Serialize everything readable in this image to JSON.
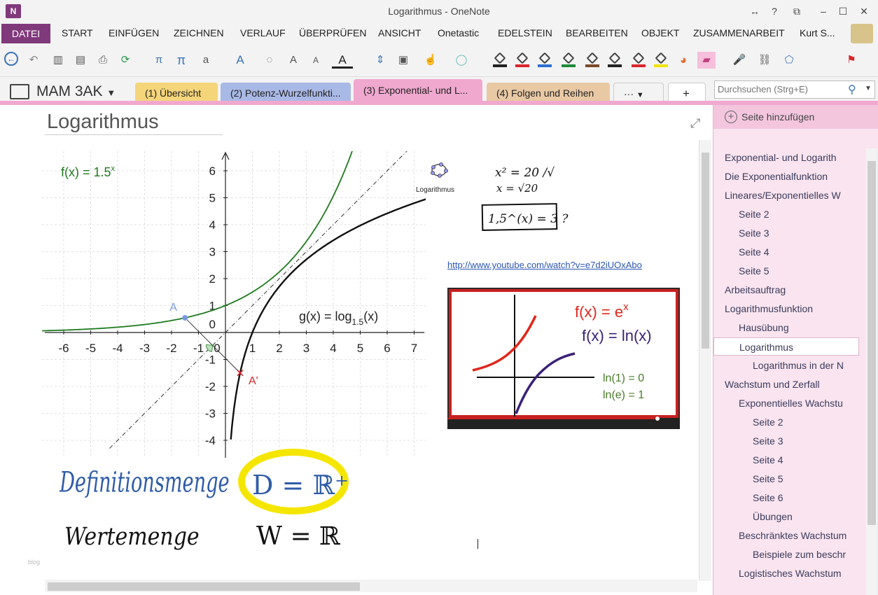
{
  "window": {
    "app_logo": "N",
    "title": "Logarithmus - OneNote",
    "controls": [
      "↔",
      "?",
      "⧉",
      "–",
      "☐",
      "✕"
    ]
  },
  "menu": {
    "active": "DATEI",
    "items": [
      "START",
      "EINFÜGEN",
      "ZEICHNEN",
      "VERLAUF",
      "ÜBERPRÜFEN",
      "ANSICHT",
      "Onetastic",
      "EDELSTEIN",
      "BEARBEITEN",
      "OBJEKT",
      "ZUSAMMENARBEIT",
      "Kurt S..."
    ]
  },
  "toolbar": {
    "icons": [
      "back-icon",
      "undo-icon",
      "dock-icon",
      "page-icon",
      "print-preview-icon",
      "sync-icon",
      "pi-symbol-icon",
      "pi-icon",
      "text-align-icon",
      "font-color-icon",
      "lasso-icon",
      "grow-font-icon",
      "shrink-font-icon",
      "text-color-icon",
      "insert-space-icon",
      "screen-clip-icon",
      "touch-icon",
      "shape-icon"
    ],
    "pen_colors": [
      "#222222",
      "#d9262b",
      "#2e6fd0",
      "#1e8a3a",
      "#7a4a2a",
      "#222222",
      "#d9262b",
      "#f2e300"
    ],
    "tool_icons": [
      "color-wheel-icon",
      "eraser-icon",
      "microphone-icon",
      "link-icon",
      "tag-icon",
      "flag-icon"
    ]
  },
  "notebook": {
    "name": "MAM 3AK",
    "sections": [
      {
        "label": "(1) Übersicht",
        "color": "#f5d57a"
      },
      {
        "label": "(2) Potenz-Wurzelfunkti...",
        "color": "#a9b9e6"
      },
      {
        "label": "(3) Exponential- und L...",
        "color": "#f0a8cf"
      },
      {
        "label": "(4) Folgen und Reihen",
        "color": "#e9c8a4"
      }
    ],
    "more": "···",
    "add_tab": "+",
    "search_placeholder": "Durchsuchen (Strg+E)"
  },
  "page": {
    "title": "Logarithmus",
    "link": "http://www.youtube.com/watch?v=e7d2iUOxAbo",
    "geogebra_label": "Logarithmus",
    "watermark": "blog"
  },
  "graph": {
    "f_label": "f(x)  =  1.5",
    "f_exp": "x",
    "g_label_pre": "g(x)  =  log",
    "g_sub": "1.5",
    "g_label_post": "(x)",
    "point_a": "A",
    "point_a_prime": "A'",
    "x_ticks": [
      "-6",
      "-5",
      "-4",
      "-3",
      "-2",
      "-1",
      "0",
      "1",
      "2",
      "3",
      "4",
      "5",
      "6",
      "7"
    ],
    "y_ticks": [
      "-4",
      "-3",
      "-2",
      "-1",
      "0",
      "1",
      "2",
      "3",
      "4",
      "5",
      "6"
    ],
    "f_color": "#1e7a1e",
    "g_color": "#111111"
  },
  "handwriting": {
    "def_label": "Definitionsmenge",
    "range_label": "Wertemenge",
    "domain": "D = ℝ⁺",
    "range": "W = ℝ"
  },
  "ink_note": {
    "line1": "x² = 20  /√",
    "line2": "x = √20",
    "boxed": "1,5^(x) = 3  ?"
  },
  "video": {
    "f1": "f(x) = e",
    "f1_exp": "x",
    "f2": "f(x) = ln(x)",
    "ln1": "ln(1) = 0",
    "lne": "ln(e) = 1"
  },
  "sidepanel": {
    "add_page": "Seite hinzufügen",
    "pages": [
      {
        "label": "Exponential- und Logarith",
        "level": 0
      },
      {
        "label": "Die Exponentialfunktion",
        "level": 0
      },
      {
        "label": "Lineares/Exponentielles W",
        "level": 0
      },
      {
        "label": "Seite 2",
        "level": 1
      },
      {
        "label": "Seite 3",
        "level": 1
      },
      {
        "label": "Seite 4",
        "level": 1
      },
      {
        "label": "Seite 5",
        "level": 1
      },
      {
        "label": "Arbeitsauftrag",
        "level": 0
      },
      {
        "label": "Logarithmusfunktion",
        "level": 0
      },
      {
        "label": "Hausübung",
        "level": 1
      },
      {
        "label": "Logarithmus",
        "level": 1,
        "selected": true
      },
      {
        "label": "Logarithmus in der N",
        "level": 2
      },
      {
        "label": "Wachstum und Zerfall",
        "level": 0
      },
      {
        "label": "Exponentielles Wachstu",
        "level": 1
      },
      {
        "label": "Seite 2",
        "level": 2
      },
      {
        "label": "Seite 3",
        "level": 2
      },
      {
        "label": "Seite 4",
        "level": 2
      },
      {
        "label": "Seite 5",
        "level": 2
      },
      {
        "label": "Seite 6",
        "level": 2
      },
      {
        "label": "Übungen",
        "level": 2
      },
      {
        "label": "Beschränktes Wachstum",
        "level": 1
      },
      {
        "label": "Beispiele zum beschr",
        "level": 2
      },
      {
        "label": "Logistisches Wachstum",
        "level": 1
      }
    ]
  }
}
